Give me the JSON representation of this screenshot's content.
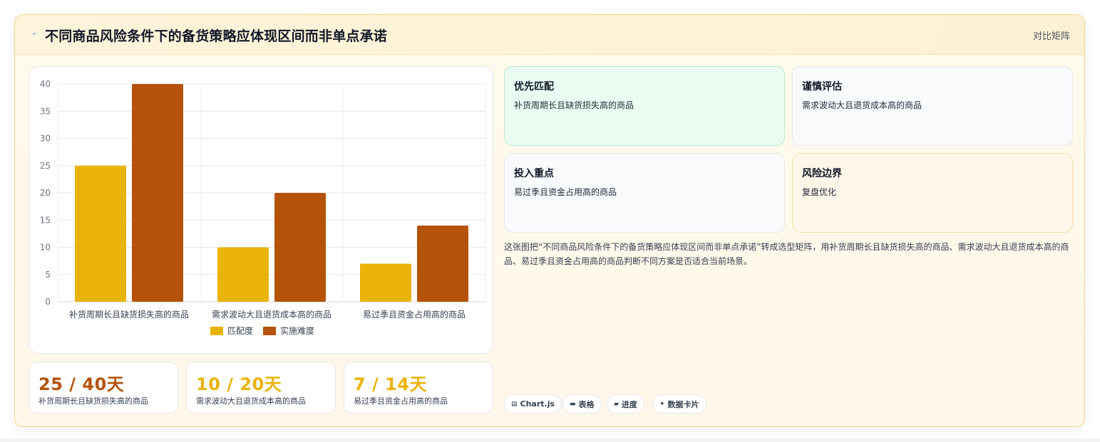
{
  "header": {
    "title": "不同商品风险条件下的备货策略应体现区间而非单点承诺",
    "link_label": "对比矩阵",
    "icon": "lightning-icon"
  },
  "chart_data": {
    "type": "bar",
    "categories": [
      "补货周期长且缺货损失高的商品",
      "需求波动大且退货成本高的商品",
      "易过季且资金占用高的商品"
    ],
    "series": [
      {
        "name": "匹配度",
        "values": [
          25,
          10,
          7
        ],
        "color": "#eab308"
      },
      {
        "name": "实施难度",
        "values": [
          40,
          20,
          14
        ],
        "color": "#b45309"
      }
    ],
    "ylim": [
      0,
      40
    ],
    "yticks": [
      0,
      5,
      10,
      15,
      20,
      25,
      30,
      35,
      40
    ],
    "grid": true,
    "legend": "bottom"
  },
  "stats": [
    {
      "value": "25 / 40天",
      "label": "补货周期长且缺货损失高的商品",
      "color": "#b45309"
    },
    {
      "value": "10 / 20天",
      "label": "需求波动大且退货成本高的商品",
      "color": "#eab308"
    },
    {
      "value": "7 / 14天",
      "label": "易过季且资金占用高的商品",
      "color": "#eab308"
    }
  ],
  "quadrants": [
    {
      "title": "优先匹配",
      "desc": "补货周期长且缺货损失高的商品"
    },
    {
      "title": "谨慎评估",
      "desc": "需求波动大且退货成本高的商品"
    },
    {
      "title": "投入重点",
      "desc": "易过季且资金占用高的商品"
    },
    {
      "title": "风险边界",
      "desc": "复盘优化"
    }
  ],
  "summary": "这张图把“不同商品风险条件下的备货策略应体现区间而非单点承诺”转成选型矩阵，用补货周期长且缺货损失高的商品、需求波动大且退货成本高的商品、易过季且资金占用高的商品判断不同方案是否适合当前场景。",
  "tags": [
    {
      "icon": "chart-icon",
      "label": "Chart.js"
    },
    {
      "icon": "table-icon",
      "label": "表格"
    },
    {
      "icon": "progress-icon",
      "label": "进度"
    },
    {
      "icon": "sparkle-icon",
      "label": "数据卡片"
    }
  ]
}
